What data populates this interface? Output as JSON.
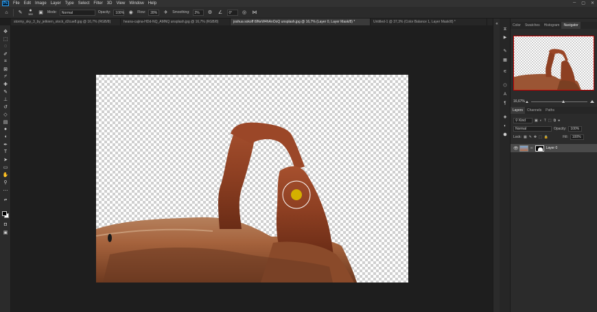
{
  "app": {
    "logo": "Ps"
  },
  "menu": [
    "File",
    "Edit",
    "Image",
    "Layer",
    "Type",
    "Select",
    "Filter",
    "3D",
    "View",
    "Window",
    "Help"
  ],
  "options": {
    "mode_label": "Mode:",
    "mode_value": "Normal",
    "opacity_label": "Opacity:",
    "opacity_value": "100%",
    "flow_label": "Flow:",
    "flow_value": "28%",
    "smoothing_label": "Smoothing:",
    "smoothing_value": "2%",
    "angle_value": "0°",
    "brush_size": "380"
  },
  "tabs": [
    "stormy_sky_3_by_jetkiern_stock_d2cue8.jpg @ 16,7% (RGB/8)",
    "heana-cajina-HDd-NQ_AMNQ unsplash.jpg @ 16,7% (RGB/8)",
    "joshua sokoff t9NeW4hAnOoQ unsplash.jpg @ 16,7% (Layer 0, Layer Mask/8) *",
    "Untitled-1 @ 37,3% (Color Balance 1, Layer Mask/8) *"
  ],
  "active_tab_index": 2,
  "top_panel": {
    "tabs": [
      "Color",
      "Swatches",
      "Histogram",
      "Navigator"
    ],
    "active": 3,
    "zoom": "16,67%",
    "zoom_fraction": 0.55
  },
  "layers_panel": {
    "tabs": [
      "Layers",
      "Channels",
      "Paths"
    ],
    "active": 0,
    "filter": "Kind",
    "blend_mode": "Normal",
    "opacity_label": "Opacity:",
    "opacity": "100%",
    "lock_label": "Lock:",
    "fill_label": "Fill:",
    "fill": "100%",
    "layers": [
      {
        "name": "Layer 0",
        "visible": true,
        "has_mask": true
      }
    ]
  },
  "colors": {
    "accent_cursor": "#d4b000",
    "foreground": "#000000",
    "background": "#ffffff"
  }
}
